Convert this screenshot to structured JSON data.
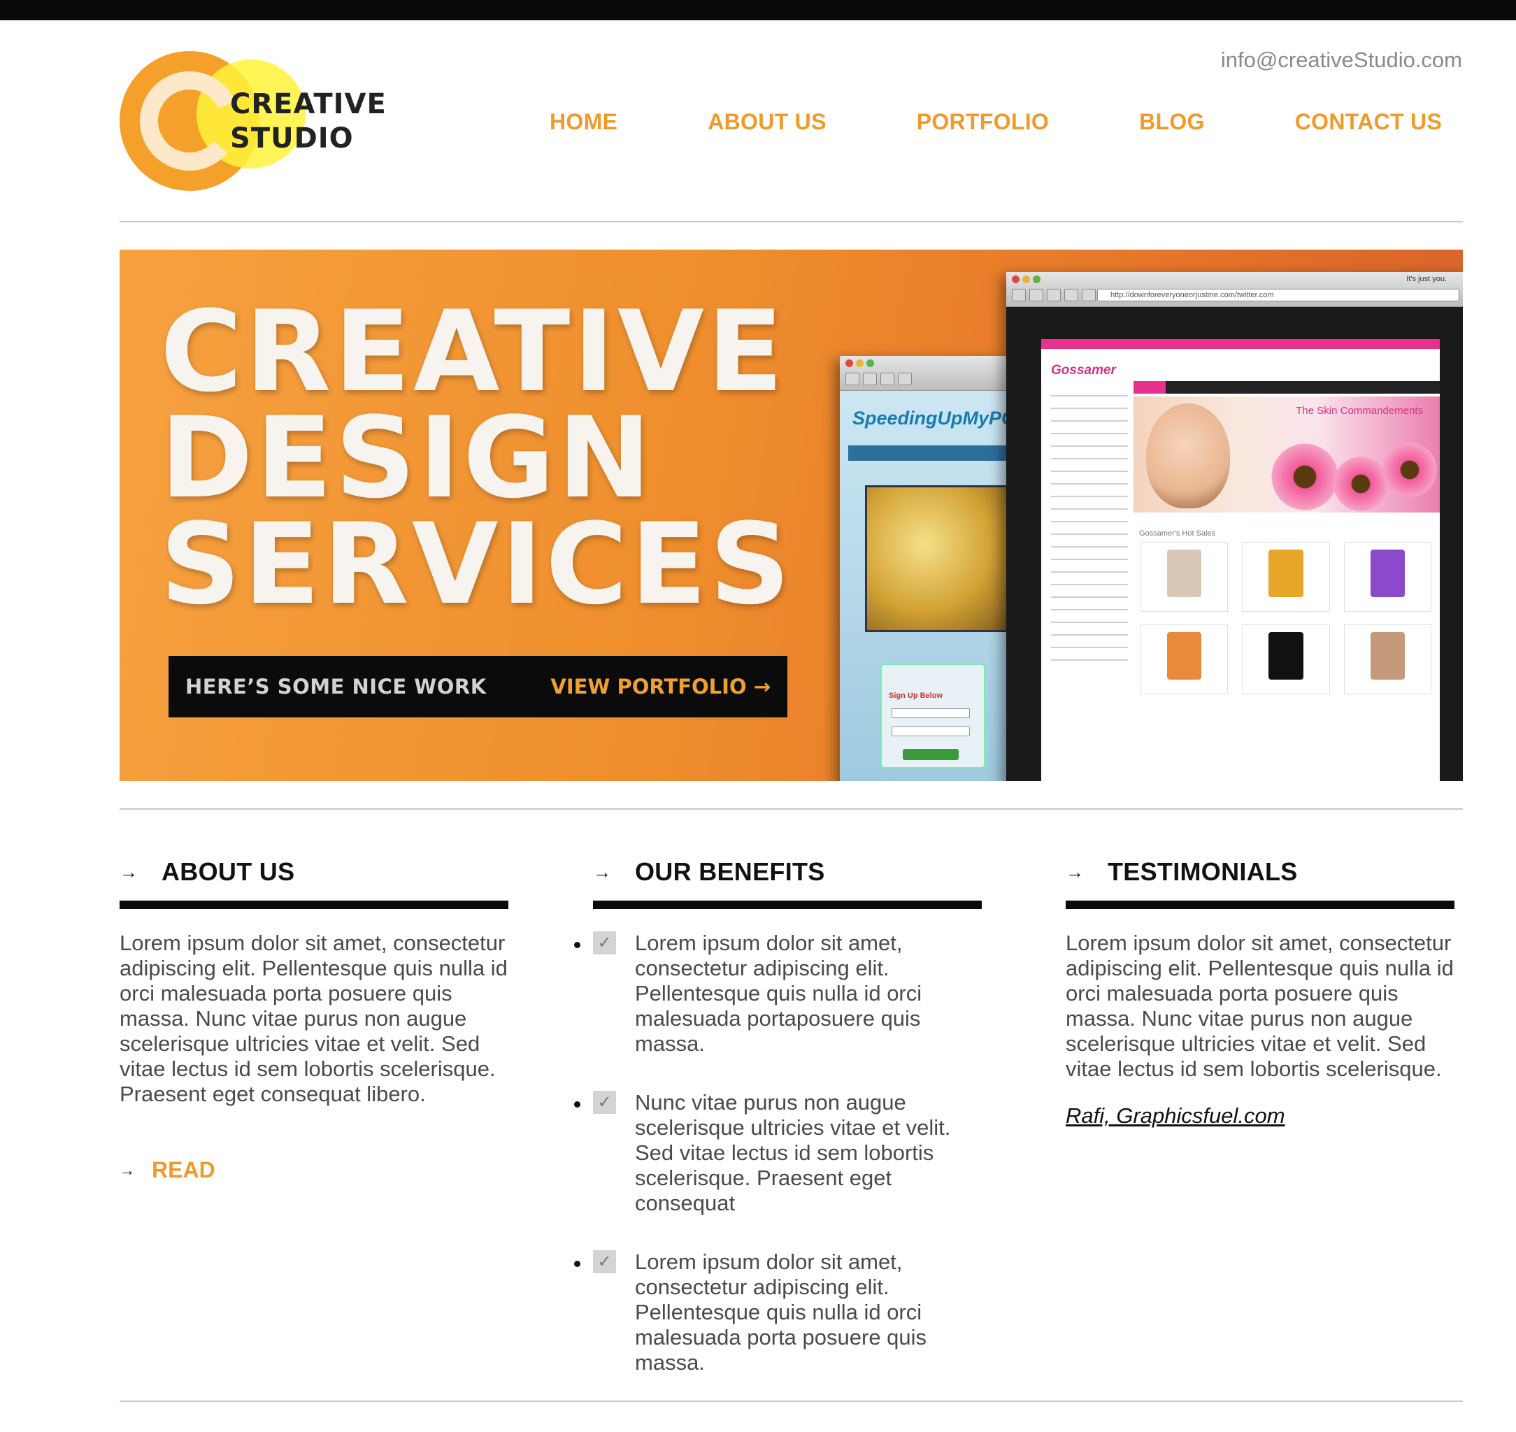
{
  "header": {
    "logo_text_line1": "CREATIVE",
    "logo_text_line2": "STUDIO",
    "email": "info@creativeStudio.com",
    "nav": [
      {
        "label": "HOME"
      },
      {
        "label": "ABOUT US"
      },
      {
        "label": "PORTFOLIO"
      },
      {
        "label": "BLOG"
      },
      {
        "label": "CONTACT US"
      }
    ]
  },
  "hero": {
    "title_line1": "CREATIVE",
    "title_line2": "DESIGN",
    "title_line3": "SERVICES",
    "cta_text": "HERE’S SOME NICE WORK",
    "cta_link": "VIEW PORTFOLIO →",
    "back_site_title": "SpeedingUpMyPC",
    "back_signup_title": "Sign Up Below",
    "front_url": "http://downforeveryoneorjustme.com/twitter.com",
    "front_window_title": "It's just you.",
    "front_brand": "Gossamer",
    "front_banner_heading": "The Skin Commandements",
    "front_hot_sales": "Gossamer's Hot Sales"
  },
  "about": {
    "arrow": "→",
    "heading": "ABOUT US",
    "body": "Lorem ipsum dolor sit amet, consectetur adipiscing elit. Pellentesque quis nulla id orci malesuada porta posuere quis massa. Nunc vitae purus non augue scelerisque ultricies vitae et velit. Sed vitae lectus id sem lobortis scelerisque. Praesent eget consequat libero.",
    "read_arrow": "→",
    "read_label": "READ"
  },
  "benefits": {
    "arrow": "→",
    "heading": "OUR BENEFITS",
    "check": "✓",
    "items": [
      {
        "text": "Lorem ipsum dolor sit amet, consectetur adipiscing elit. Pellentesque quis nulla id orci malesuada portaposuere quis massa."
      },
      {
        "text": "Nunc vitae purus non augue scelerisque ultricies vitae et velit. Sed vitae lectus id sem lobortis scelerisque. Praesent eget consequat"
      },
      {
        "text": "Lorem ipsum dolor sit amet, consectetur adipiscing elit. Pellentesque quis nulla id orci malesuada porta posuere quis massa."
      }
    ]
  },
  "testimonials": {
    "arrow": "→",
    "heading": "TESTIMONIALS",
    "body": "Lorem ipsum dolor sit amet, consectetur adipiscing elit. Pellentesque quis nulla id orci malesuada porta posuere quis massa. Nunc vitae purus non augue scelerisque ultricies vitae et velit. Sed vitae lectus id sem lobortis scelerisque.",
    "author": "Rafi, Graphicsfuel.com"
  },
  "colors": {
    "accent": "#f09a2b",
    "topbar": "#0a0a0a",
    "hero_orange": "#ef8f2e",
    "logo_orange": "#f5a02a",
    "logo_yellow": "#fff33a"
  }
}
